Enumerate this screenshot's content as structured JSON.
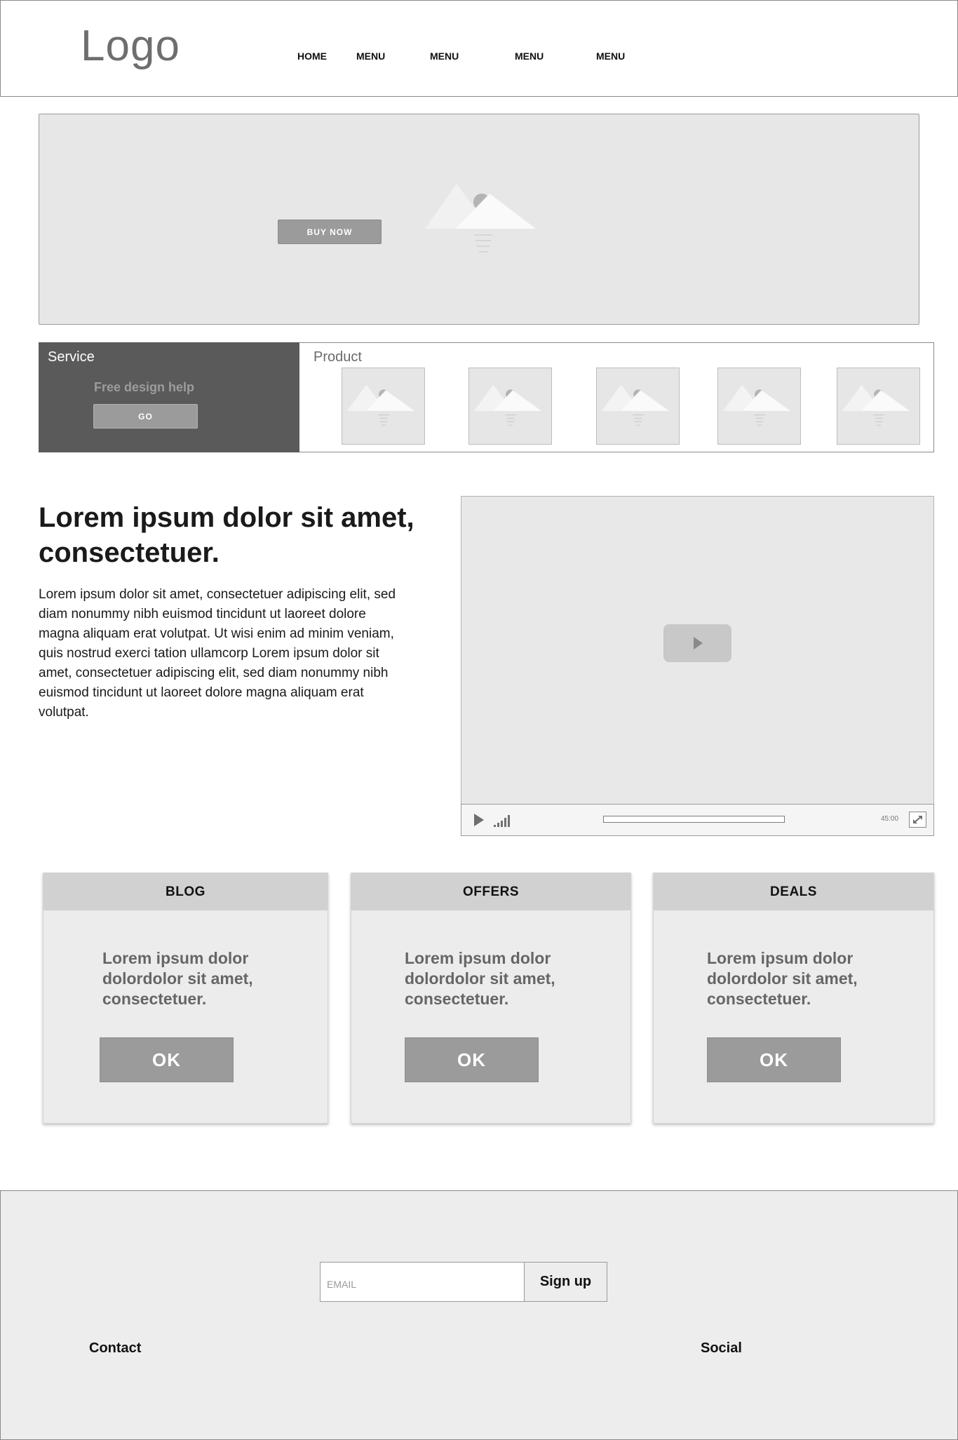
{
  "header": {
    "logo": "Logo",
    "nav": [
      "HOME",
      "MENU",
      "MENU",
      "MENU",
      "MENU"
    ]
  },
  "hero": {
    "image_icon": "image-placeholder-icon",
    "button_label": "BUY NOW"
  },
  "service": {
    "title": "Service",
    "subtitle": "Free design help",
    "button_label": "GO"
  },
  "product": {
    "title": "Product",
    "thumbnail_icon": "image-placeholder-icon"
  },
  "content": {
    "headline": "Lorem ipsum dolor sit amet, consectetuer.",
    "body": "Lorem ipsum dolor sit amet, consectetuer adipiscing elit, sed diam nonummy nibh euismod tincidunt ut laoreet dolore magna aliquam erat volutpat. Ut wisi enim ad minim veniam, quis nostrud exerci tation ullamcorp Lorem ipsum dolor sit amet, consectetuer adipiscing elit, sed diam nonummy nibh euismod tincidunt ut laoreet dolore magna aliquam erat volutpat."
  },
  "video": {
    "play_icon": "play-icon",
    "volume_icon": "volume-icon",
    "fullscreen_icon": "fullscreen-icon",
    "time": "45:00",
    "progress": 0
  },
  "cards": [
    {
      "title": "BLOG",
      "text": "Lorem ipsum dolor dolordolor sit amet, consectetuer.",
      "button": "OK"
    },
    {
      "title": "OFFERS",
      "text": "Lorem ipsum dolor dolordolor sit amet, consectetuer.",
      "button": "OK"
    },
    {
      "title": "DEALS",
      "text": "Lorem ipsum dolor dolordolor sit amet, consectetuer.",
      "button": "OK"
    }
  ],
  "footer": {
    "email_placeholder": "EMAIL",
    "signup_label": "Sign up",
    "contact_label": "Contact",
    "social_label": "Social"
  },
  "colors": {
    "dark_panel": "#595a59",
    "button_gray": "#9b9b9b",
    "placeholder_bg": "#e7e7e7"
  }
}
